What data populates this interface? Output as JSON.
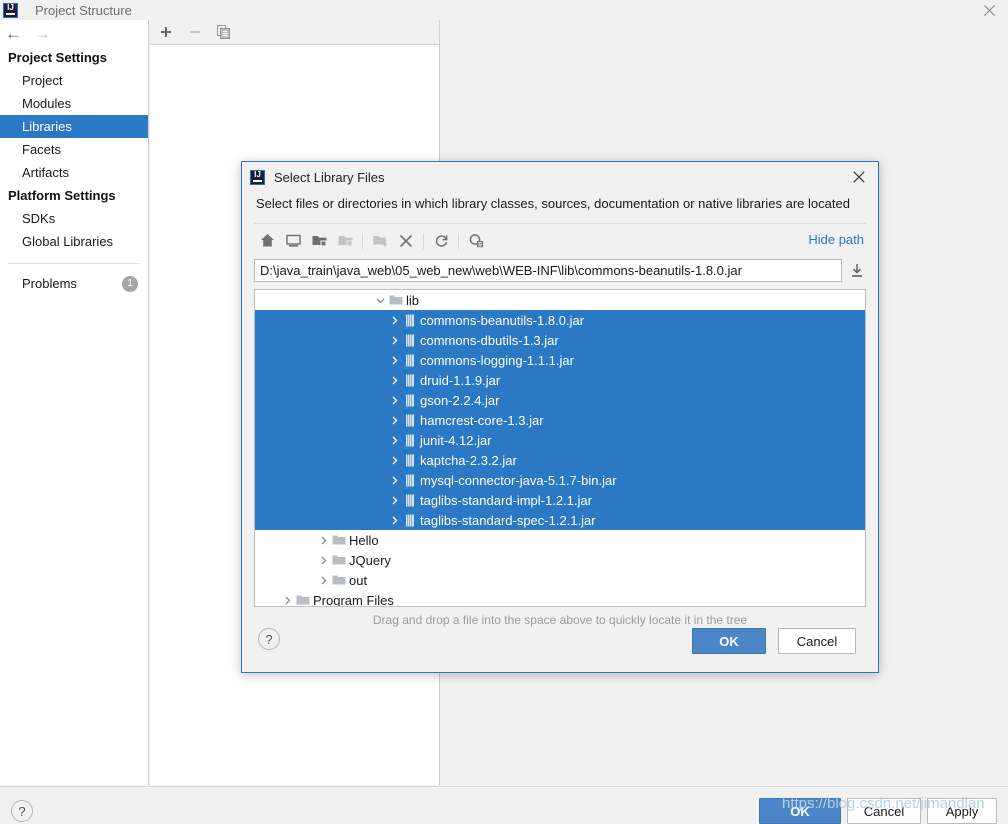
{
  "window": {
    "title": "Project Structure",
    "logo_icon": "intellij-idea-logo",
    "close_icon": "close-icon",
    "nav_back_icon": "arrow-left-icon",
    "nav_forward_icon": "arrow-right-icon"
  },
  "sidebar": {
    "groups": [
      {
        "title": "Project Settings",
        "items": [
          {
            "label": "Project",
            "selected": false
          },
          {
            "label": "Modules",
            "selected": false
          },
          {
            "label": "Libraries",
            "selected": true
          },
          {
            "label": "Facets",
            "selected": false
          },
          {
            "label": "Artifacts",
            "selected": false
          }
        ]
      },
      {
        "title": "Platform Settings",
        "items": [
          {
            "label": "SDKs",
            "selected": false
          },
          {
            "label": "Global Libraries",
            "selected": false
          }
        ]
      }
    ],
    "problems": {
      "label": "Problems",
      "count": "1"
    }
  },
  "list_toolbar": {
    "add": {
      "icon": "plus-icon",
      "label": "+"
    },
    "remove": {
      "icon": "minus-icon",
      "label": "−"
    },
    "copy": {
      "icon": "copy-icon"
    }
  },
  "window_footer": {
    "help_icon": "question-mark-icon",
    "ok_label": "OK",
    "cancel_label": "Cancel",
    "apply_label": "Apply"
  },
  "watermark": {
    "text": "https://blog.csdn.net/jimandlan"
  },
  "dialog": {
    "logo_icon": "intellij-idea-logo",
    "title": "Select Library Files",
    "close_icon": "close-icon",
    "description": "Select files or directories in which library classes, sources, documentation or native libraries are located",
    "toolbar": [
      {
        "name": "home-icon",
        "enabled": true
      },
      {
        "name": "desktop-icon",
        "enabled": true
      },
      {
        "name": "expand-folder-icon",
        "enabled": true
      },
      {
        "name": "collapse-folder-icon",
        "enabled": false
      },
      {
        "name": "new-folder-icon",
        "enabled": false
      },
      {
        "name": "delete-icon",
        "enabled": true
      },
      {
        "name": "refresh-icon",
        "enabled": true
      },
      {
        "name": "show-hidden-files-icon",
        "enabled": true
      }
    ],
    "hide_path_label": "Hide path",
    "path": {
      "value": "D:\\java_train\\java_web\\05_web_new\\web\\WEB-INF\\lib\\commons-beanutils-1.8.0.jar",
      "placeholder": "",
      "download_icon": "download-icon"
    },
    "tree": [
      {
        "label": "lib",
        "icon": "folder-icon",
        "twisty": "chevron-down-icon",
        "indent": 119,
        "selected": false
      },
      {
        "label": "commons-beanutils-1.8.0.jar",
        "icon": "jar-icon",
        "twisty": "chevron-right-icon",
        "indent": 133,
        "selected": true
      },
      {
        "label": "commons-dbutils-1.3.jar",
        "icon": "jar-icon",
        "twisty": "chevron-right-icon",
        "indent": 133,
        "selected": true
      },
      {
        "label": "commons-logging-1.1.1.jar",
        "icon": "jar-icon",
        "twisty": "chevron-right-icon",
        "indent": 133,
        "selected": true
      },
      {
        "label": "druid-1.1.9.jar",
        "icon": "jar-icon",
        "twisty": "chevron-right-icon",
        "indent": 133,
        "selected": true
      },
      {
        "label": "gson-2.2.4.jar",
        "icon": "jar-icon",
        "twisty": "chevron-right-icon",
        "indent": 133,
        "selected": true
      },
      {
        "label": "hamcrest-core-1.3.jar",
        "icon": "jar-icon",
        "twisty": "chevron-right-icon",
        "indent": 133,
        "selected": true
      },
      {
        "label": "junit-4.12.jar",
        "icon": "jar-icon",
        "twisty": "chevron-right-icon",
        "indent": 133,
        "selected": true
      },
      {
        "label": "kaptcha-2.3.2.jar",
        "icon": "jar-icon",
        "twisty": "chevron-right-icon",
        "indent": 133,
        "selected": true
      },
      {
        "label": "mysql-connector-java-5.1.7-bin.jar",
        "icon": "jar-icon",
        "twisty": "chevron-right-icon",
        "indent": 133,
        "selected": true
      },
      {
        "label": "taglibs-standard-impl-1.2.1.jar",
        "icon": "jar-icon",
        "twisty": "chevron-right-icon",
        "indent": 133,
        "selected": true
      },
      {
        "label": "taglibs-standard-spec-1.2.1.jar",
        "icon": "jar-icon",
        "twisty": "chevron-right-icon",
        "indent": 133,
        "selected": true
      },
      {
        "label": "Hello",
        "icon": "folder-icon",
        "twisty": "chevron-right-icon",
        "indent": 62,
        "selected": false
      },
      {
        "label": "JQuery",
        "icon": "folder-icon",
        "twisty": "chevron-right-icon",
        "indent": 62,
        "selected": false
      },
      {
        "label": "out",
        "icon": "folder-icon",
        "twisty": "chevron-right-icon",
        "indent": 62,
        "selected": false
      },
      {
        "label": "Program Files",
        "icon": "folder-icon",
        "twisty": "chevron-right-icon",
        "indent": 26,
        "selected": false
      }
    ],
    "drag_hint": "Drag and drop a file into the space above to quickly locate it in the tree",
    "help_icon": "question-mark-icon",
    "ok_label": "OK",
    "cancel_label": "Cancel"
  },
  "colors": {
    "selection_blue": "#2b78c4",
    "primary_button": "#4a86c8",
    "link_blue": "#2b78c4",
    "badge_gray": "#a6a6a6",
    "watermark": "#b8cfe4"
  }
}
